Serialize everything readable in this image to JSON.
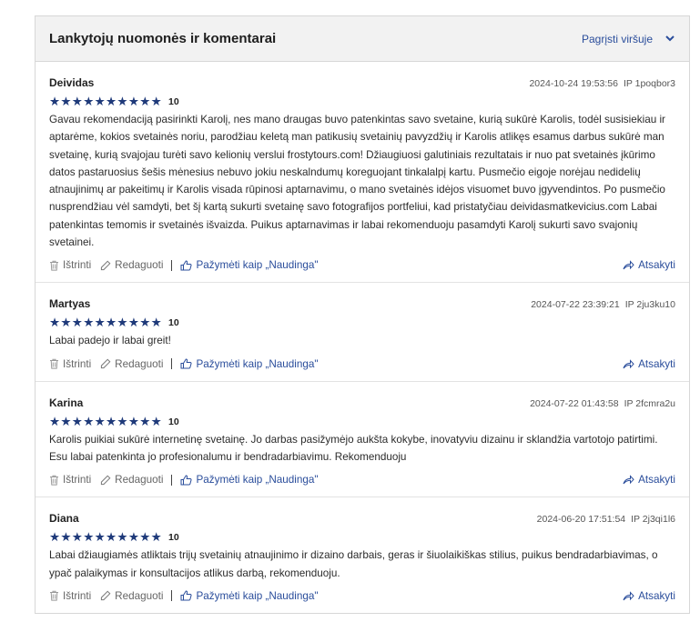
{
  "header": {
    "title": "Lankytojų nuomonės ir komentarai",
    "sort_label": "Pagrįsti viršuje"
  },
  "labels": {
    "delete": "Ištrinti",
    "edit": "Redaguoti",
    "mark_useful": "Pažymėti kaip „Naudinga\"",
    "reply": "Atsakyti",
    "stars": "★★★★★★★★★★"
  },
  "reviews": [
    {
      "author": "Deividas",
      "datetime": "2024-10-24 19:53:56",
      "ip": "IP 1poqbor3",
      "score": "10",
      "text": "Gavau rekomendaciją pasirinkti Karolį, nes mano draugas buvo patenkintas savo svetaine, kurią sukūrė Karolis, todėl susisiekiau ir aptarėme, kokios svetainės noriu, parodžiau keletą man patikusių svetainių pavyzdžių ir Karolis atlikęs esamus darbus sukūrė man svetainę, kurią svajojau turėti savo kelionių verslui frostytours.com! Džiaugiuosi galutiniais rezultatais ir nuo pat svetainės įkūrimo datos pastaruosius šešis mėnesius nebuvo jokiu neskalndumų koreguojant tinkalalpį kartu. Pusmečio eigoje norėjau nedidelių atnaujinimų ar pakeitimų ir Karolis visada rūpinosi aptarnavimu, o mano svetainės idėjos visuomet buvo įgyvendintos. Po pusmečio nusprendžiau vėl samdyti, bet šį kartą sukurti svetainę savo fotografijos portfeliui, kad pristatyčiau deividasmatkevicius.com Labai patenkintas temomis ir svetainės išvaizda. Puikus aptarnavimas ir labai rekomenduoju pasamdyti Karolį sukurti savo svajonių svetainei."
    },
    {
      "author": "Martyas",
      "datetime": "2024-07-22 23:39:21",
      "ip": "IP 2ju3ku10",
      "score": "10",
      "text": "Labai padejo ir labai greit!"
    },
    {
      "author": "Karina",
      "datetime": "2024-07-22 01:43:58",
      "ip": "IP 2fcmra2u",
      "score": "10",
      "text": "Karolis puikiai sukūrė internetinę svetainę. Jo darbas pasižymėjo aukšta kokybe, inovatyviu dizainu ir sklandžia vartotojo patirtimi. Esu labai patenkinta jo profesionalumu ir bendradarbiavimu. Rekomenduoju"
    },
    {
      "author": "Diana",
      "datetime": "2024-06-20 17:51:54",
      "ip": "IP 2j3qi1l6",
      "score": "10",
      "text": "Labai džiaugiamės atliktais trijų svetainių atnaujinimo ir dizaino darbais, geras ir šiuolaikiškas stilius, puikus bendradarbiavimas, o ypač palaikymas ir konsultacijos atlikus darbą, rekomenduoju."
    }
  ]
}
